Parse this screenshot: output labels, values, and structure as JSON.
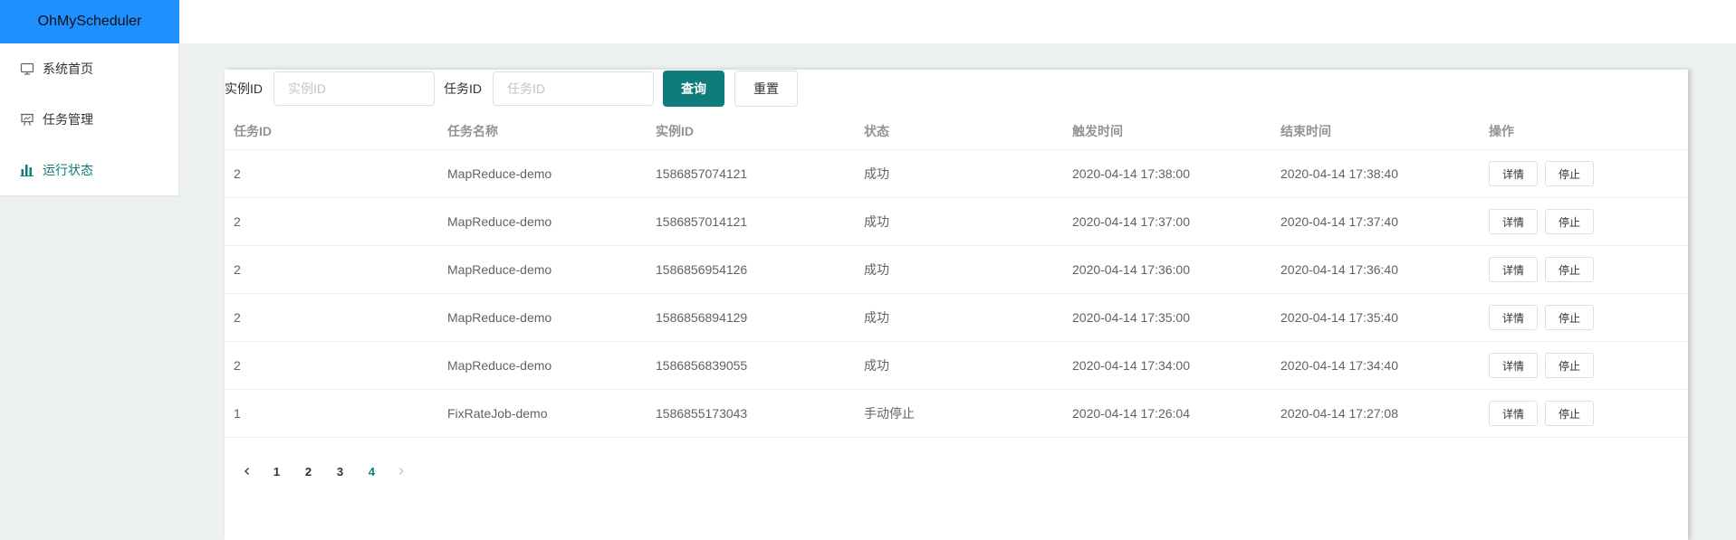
{
  "app": {
    "title": "OhMyScheduler"
  },
  "sidebar": {
    "items": [
      {
        "label": "系统首页",
        "icon": "monitor-icon"
      },
      {
        "label": "任务管理",
        "icon": "presentation-icon"
      },
      {
        "label": "运行状态",
        "icon": "bar-chart-icon",
        "active": true
      }
    ]
  },
  "colors": {
    "brand": "#1e90ff",
    "accent": "#0e7c7b"
  },
  "search": {
    "instance_label": "实例ID",
    "instance_placeholder": "实例ID",
    "instance_value": "",
    "job_label": "任务ID",
    "job_placeholder": "任务ID",
    "job_value": "",
    "query_label": "查询",
    "reset_label": "重置"
  },
  "table": {
    "headers": [
      "任务ID",
      "任务名称",
      "实例ID",
      "状态",
      "触发时间",
      "结束时间",
      "操作"
    ],
    "action_labels": {
      "detail": "详情",
      "stop": "停止"
    },
    "rows": [
      {
        "job_id": "2",
        "job_name": "MapReduce-demo",
        "instance_id": "1586857074121",
        "status": "成功",
        "trigger_time": "2020-04-14 17:38:00",
        "finish_time": "2020-04-14 17:38:40"
      },
      {
        "job_id": "2",
        "job_name": "MapReduce-demo",
        "instance_id": "1586857014121",
        "status": "成功",
        "trigger_time": "2020-04-14 17:37:00",
        "finish_time": "2020-04-14 17:37:40"
      },
      {
        "job_id": "2",
        "job_name": "MapReduce-demo",
        "instance_id": "1586856954126",
        "status": "成功",
        "trigger_time": "2020-04-14 17:36:00",
        "finish_time": "2020-04-14 17:36:40"
      },
      {
        "job_id": "2",
        "job_name": "MapReduce-demo",
        "instance_id": "1586856894129",
        "status": "成功",
        "trigger_time": "2020-04-14 17:35:00",
        "finish_time": "2020-04-14 17:35:40"
      },
      {
        "job_id": "2",
        "job_name": "MapReduce-demo",
        "instance_id": "1586856839055",
        "status": "成功",
        "trigger_time": "2020-04-14 17:34:00",
        "finish_time": "2020-04-14 17:34:40"
      },
      {
        "job_id": "1",
        "job_name": "FixRateJob-demo",
        "instance_id": "1586855173043",
        "status": "手动停止",
        "trigger_time": "2020-04-14 17:26:04",
        "finish_time": "2020-04-14 17:27:08"
      }
    ]
  },
  "pagination": {
    "pages": [
      "1",
      "2",
      "3",
      "4"
    ],
    "current": "4"
  }
}
